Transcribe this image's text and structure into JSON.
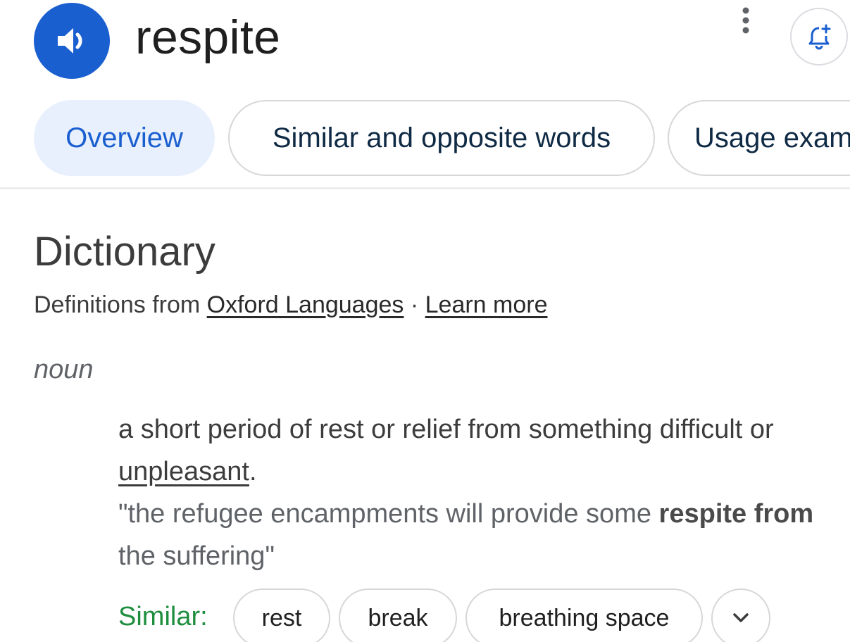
{
  "header": {
    "word": "respite",
    "speaker_icon": "volume-icon",
    "more_icon": "more-vert-icon",
    "alert_icon": "bell-plus-icon"
  },
  "tabs": [
    {
      "label": "Overview",
      "active": true
    },
    {
      "label": "Similar and opposite words",
      "active": false
    },
    {
      "label": "Usage examples",
      "active": false
    }
  ],
  "dictionary": {
    "title": "Dictionary",
    "source_prefix": "Definitions from ",
    "source_link": "Oxford Languages",
    "separator": " · ",
    "learn_more": "Learn more",
    "part_of_speech": "noun",
    "definition_text": "a short period of rest or relief from something difficult or ",
    "definition_link": "unpleasant",
    "definition_end": ".",
    "example_start": "\"the refugee encampments will provide some ",
    "example_bold": "respite from",
    "example_end": " the suffering\"",
    "similar_label": "Similar:",
    "similar_words": [
      "rest",
      "break",
      "breathing space"
    ],
    "expand_icon": "chevron-down-icon"
  },
  "colors": {
    "accent": "#1a5fd0",
    "active_tab_bg": "#e8f0fd",
    "similar_green": "#1e8e3e"
  }
}
